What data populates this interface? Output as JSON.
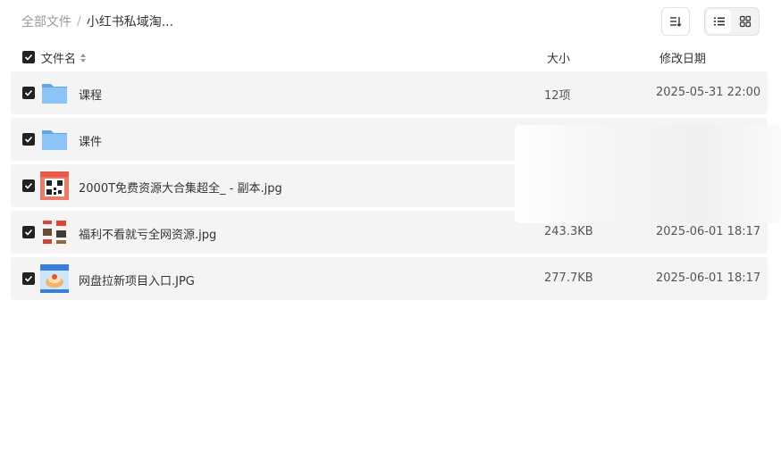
{
  "breadcrumb": {
    "root": "全部文件",
    "separator": "/",
    "current": "小红书私域淘..."
  },
  "toolbar": {
    "sort_icon": "sort-lines-icon",
    "list_view_icon": "list-view-icon",
    "grid_view_icon": "grid-view-icon"
  },
  "header": {
    "name": "文件名",
    "size": "大小",
    "date": "修改日期"
  },
  "files": [
    {
      "type": "folder",
      "name": "课程",
      "size": "12项",
      "date": "2025-05-31 22:00"
    },
    {
      "type": "folder",
      "name": "课件",
      "size": "",
      "date": ""
    },
    {
      "type": "image",
      "name": "2000T免费资源大合集超全_ - 副本.jpg",
      "size": "",
      "date": ""
    },
    {
      "type": "image",
      "name": "福利不看就亏全网资源.jpg",
      "size": "243.3KB",
      "date": "2025-06-01 18:17"
    },
    {
      "type": "image",
      "name": "网盘拉新项目入口.JPG",
      "size": "277.7KB",
      "date": "2025-06-01 18:17"
    }
  ],
  "colors": {
    "row_bg": "#f4f4f4",
    "checkbox": "#222222",
    "folder": "#7ab8f0"
  }
}
